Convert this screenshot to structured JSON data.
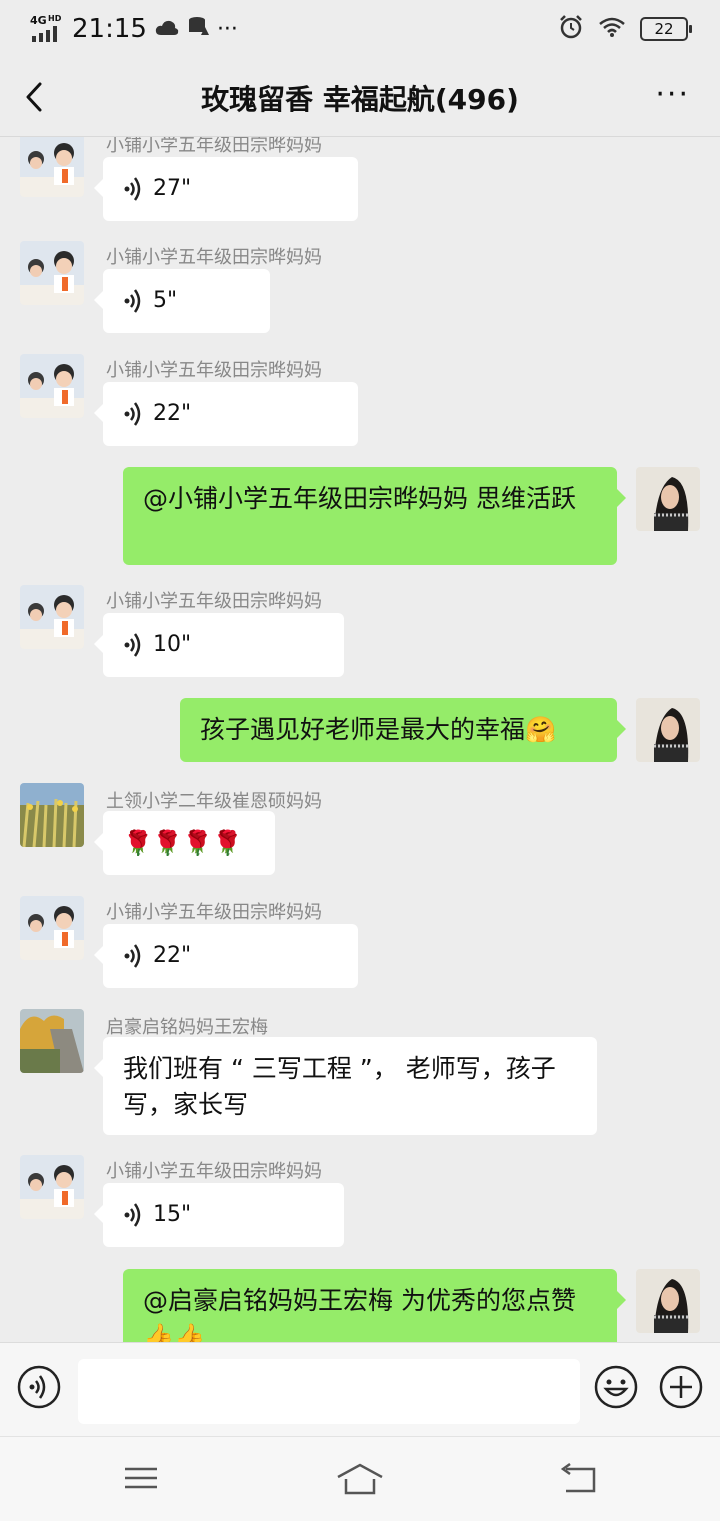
{
  "status": {
    "network": "4G",
    "network_sup": "HD",
    "time": "21:15",
    "more_dots": "···",
    "battery": "22"
  },
  "header": {
    "title": "玫瑰留香  幸福起航(496)",
    "more": "···"
  },
  "messages": [
    {
      "side": "left",
      "sender": "小铺小学五年级田宗晔妈妈",
      "type": "voice",
      "duration": "27\""
    },
    {
      "side": "left",
      "sender": "小铺小学五年级田宗晔妈妈",
      "type": "voice",
      "duration": "5\""
    },
    {
      "side": "left",
      "sender": "小铺小学五年级田宗晔妈妈",
      "type": "voice",
      "duration": "22\""
    },
    {
      "side": "right",
      "type": "text",
      "text": "@小铺小学五年级田宗晔妈妈  思维活跃"
    },
    {
      "side": "left",
      "sender": "小铺小学五年级田宗晔妈妈",
      "type": "voice",
      "duration": "10\""
    },
    {
      "side": "right",
      "type": "text",
      "text": "孩子遇见好老师是最大的幸福",
      "emoji": "🤗"
    },
    {
      "side": "left",
      "sender": "土领小学二年级崔恩硕妈妈",
      "type": "text",
      "text": "🌹🌹🌹🌹"
    },
    {
      "side": "left",
      "sender": "小铺小学五年级田宗晔妈妈",
      "type": "voice",
      "duration": "22\""
    },
    {
      "side": "left",
      "sender": "启豪启铭妈妈王宏梅",
      "type": "text",
      "text": "我们班有 “ 三写工程 ”， 老师写，孩子写，家长写"
    },
    {
      "side": "left",
      "sender": "小铺小学五年级田宗晔妈妈",
      "type": "voice",
      "duration": "15\""
    },
    {
      "side": "right",
      "type": "text",
      "text": "@启豪启铭妈妈王宏梅  为优秀的您点赞👍👍"
    }
  ],
  "input": {
    "placeholder": ""
  },
  "icons": {
    "voice": "voice-input-icon",
    "emoji": "emoji-icon",
    "plus": "plus-icon",
    "nav_menu": "menu-icon",
    "nav_home": "home-icon",
    "nav_back": "back-nav-icon"
  }
}
